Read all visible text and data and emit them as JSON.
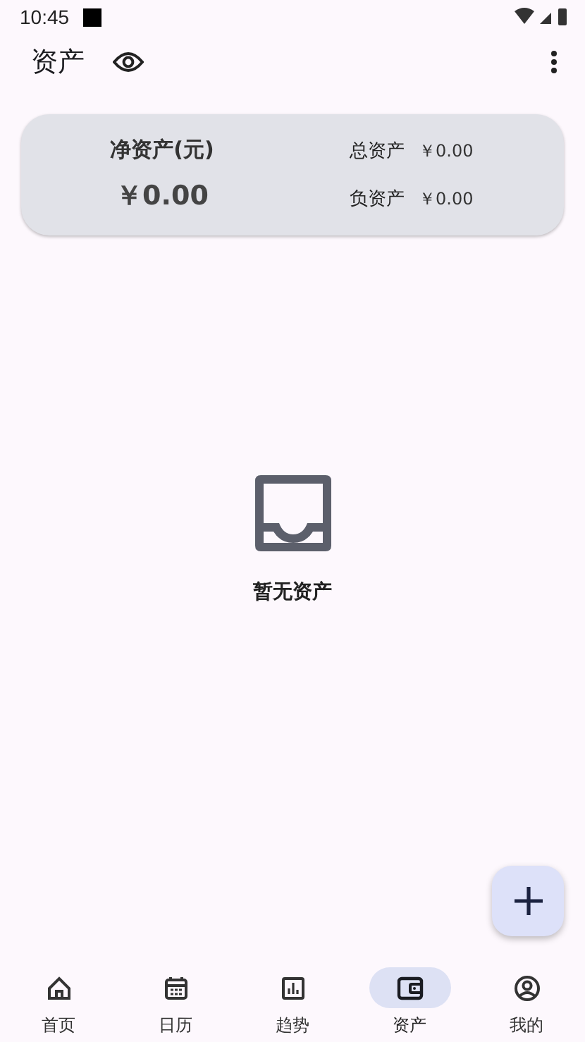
{
  "status_bar": {
    "time": "10:45"
  },
  "app_bar": {
    "title": "资产"
  },
  "summary": {
    "net_label": "净资产(元)",
    "net_value": "￥0.00",
    "rows": [
      {
        "label": "总资产",
        "value": "￥0.00"
      },
      {
        "label": "负资产",
        "value": "￥0.00"
      }
    ]
  },
  "empty_state": {
    "text": "暂无资产"
  },
  "nav": [
    {
      "kind": "home",
      "label": "首页",
      "selected": false
    },
    {
      "kind": "calendar",
      "label": "日历",
      "selected": false
    },
    {
      "kind": "chart",
      "label": "趋势",
      "selected": false
    },
    {
      "kind": "wallet",
      "label": "资产",
      "selected": true
    },
    {
      "kind": "profile",
      "label": "我的",
      "selected": false
    }
  ]
}
